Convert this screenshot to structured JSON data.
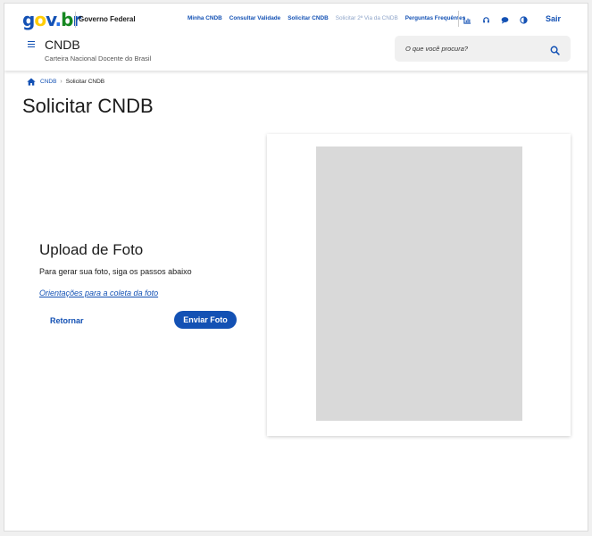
{
  "header": {
    "logo": {
      "g": "g",
      "o1": "o",
      "v": "v",
      "dot": ".",
      "b": "b",
      "r": "r"
    },
    "org_name": "Governo Federal",
    "links": [
      {
        "label": "Minha CNDB"
      },
      {
        "label": "Consultar Validade"
      },
      {
        "label": "Solicitar CNDB"
      },
      {
        "label": "Solicitar 2ª Via da CNDB"
      },
      {
        "label": "Perguntas Frequêntes"
      }
    ],
    "tool_icons": [
      "chart-icon",
      "headset-icon",
      "chat-icon",
      "contrast-icon"
    ],
    "exit_label": "Sair",
    "site_title": "CNDB",
    "site_subtitle": "Carteira Nacional Docente do Brasil",
    "search_placeholder": "O que você procura?"
  },
  "breadcrumb": {
    "home": "CNDB",
    "current": "Solicitar CNDB"
  },
  "page_title": "Solicitar CNDB",
  "upload": {
    "title": "Upload de Foto",
    "description": "Para gerar sua foto, siga os passos abaixo",
    "guide_link": "Orientações para a coleta da foto",
    "back_label": "Retornar",
    "send_label": "Enviar Foto"
  },
  "colors": {
    "primary": "#1351b4",
    "photo_placeholder": "#d9d9d9"
  }
}
